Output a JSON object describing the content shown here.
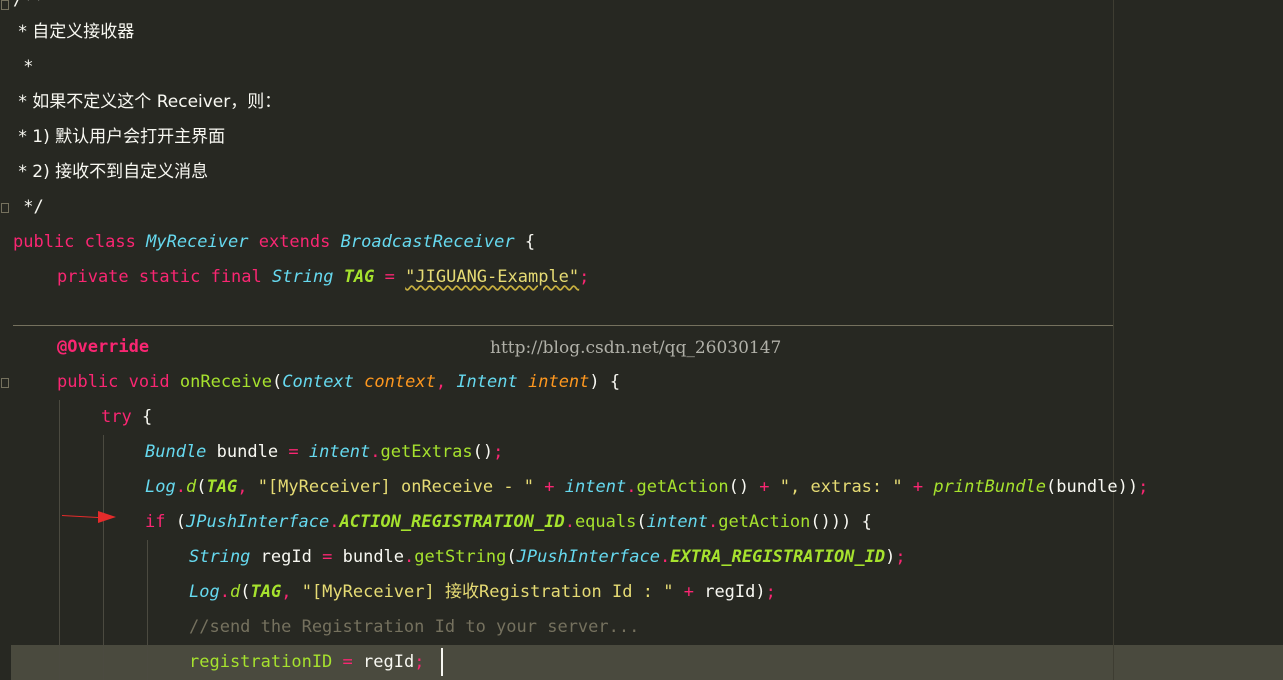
{
  "editor": {
    "lines": [
      "/**",
      " * 自定义接收器",
      " *",
      " * 如果不定义这个 Receiver，则：",
      " * 1) 默认用户会打开主界面",
      " * 2) 接收不到自定义消息",
      " */"
    ],
    "watermark": "http://blog.csdn.net/qq_26030147",
    "colors": {
      "background": "#272822",
      "keyword": "#f92672",
      "type": "#66d9ef",
      "function": "#a6e22e",
      "string": "#e6db74",
      "current_line": "#4a4a3e"
    },
    "icons": [
      "breakpoint-arrow-icon",
      "fold-marker-icon"
    ]
  },
  "code": {
    "kw_public": "public",
    "kw_class": "class",
    "class_name": "MyReceiver",
    "kw_extends": "extends",
    "super_class": "BroadcastReceiver",
    "brace_open": " {",
    "kw_private": "private",
    "kw_static": "static",
    "kw_final": "final",
    "type_string": "String",
    "tag": "TAG",
    "eq": "=",
    "tag_value": "\"JIGUANG-Example\"",
    "semi": ";",
    "annotation": "@Override",
    "kw_void": "void",
    "method_onreceive": "onReceive",
    "type_context": "Context",
    "param_context": "context",
    "type_intent": "Intent",
    "param_intent": "intent",
    "kw_try": "try",
    "type_bundle": "Bundle",
    "var_bundle": "bundle",
    "method_getextras": "getExtras",
    "log": "Log",
    "method_d": "d",
    "str_onreceive": "\"[MyReceiver] onReceive - \"",
    "plus": "+",
    "method_getaction": "getAction",
    "str_extras": "\", extras: \"",
    "method_printbundle": "printBundle",
    "kw_if": "if",
    "jpush": "JPushInterface",
    "const_action": "ACTION_REGISTRATION_ID",
    "method_equals": "equals",
    "var_regid": "regId",
    "method_getstring": "getString",
    "const_extra": "EXTRA_REGISTRATION_ID",
    "str_regid": "\"[MyReceiver] 接收Registration Id : \"",
    "comment_send": "//send the Registration Id to your server...",
    "var_registrationid": "registrationID"
  }
}
